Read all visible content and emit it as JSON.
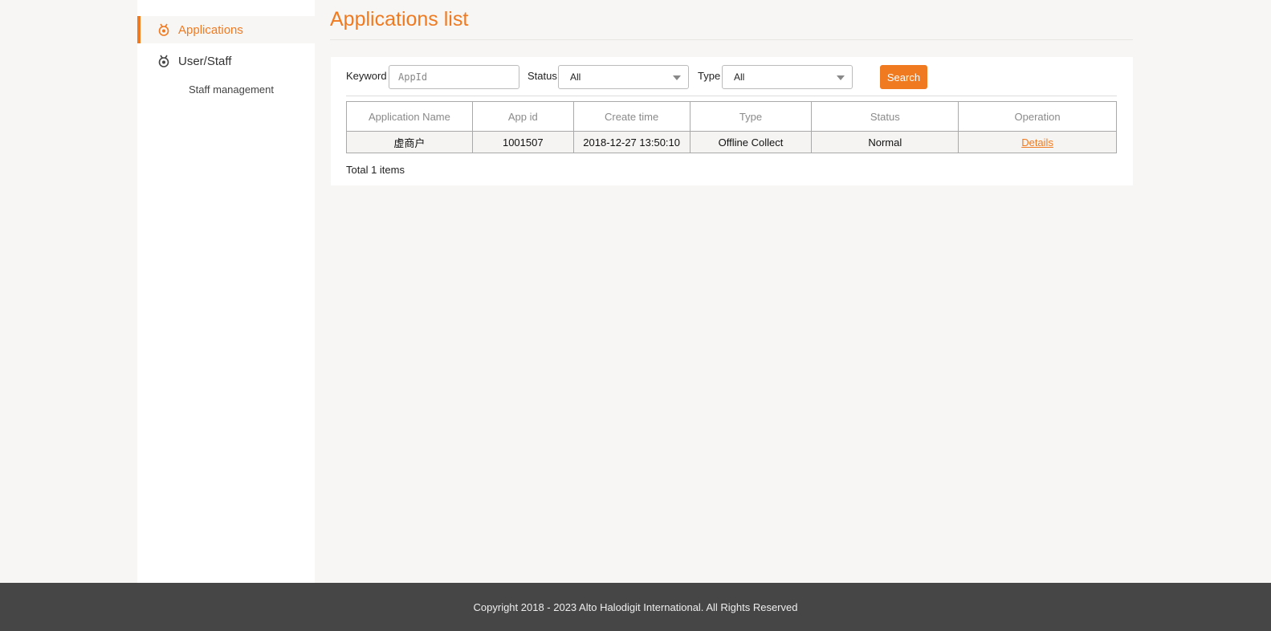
{
  "sidebar": {
    "items": [
      {
        "label": "Applications",
        "icon": "badge-icon",
        "active": true
      },
      {
        "label": "User/Staff",
        "icon": "badge-icon",
        "active": false
      }
    ],
    "sub_items": [
      {
        "label": "Staff management"
      }
    ]
  },
  "main": {
    "title": "Applications list",
    "filters": {
      "keyword_label": "Keyword",
      "keyword_placeholder": "AppId",
      "status_label": "Status",
      "status_value": "All",
      "type_label": "Type",
      "type_value": "All",
      "search_label": "Search"
    },
    "table": {
      "columns": [
        "Application Name",
        "App id",
        "Create time",
        "Type",
        "Status",
        "Operation"
      ],
      "rows": [
        [
          "虚商户",
          "1001507",
          "2018-12-27 13:50:10",
          "Offline Collect",
          "Normal",
          "Details"
        ]
      ]
    },
    "total_text": "Total 1 items"
  },
  "footer": {
    "copyright": "Copyright 2018 - 2023 Alto Halodigit International. All Rights Reserved"
  },
  "colors": {
    "accent": "#f07a20",
    "footer_bg": "#464646",
    "page_bg": "#f7f6f4"
  }
}
